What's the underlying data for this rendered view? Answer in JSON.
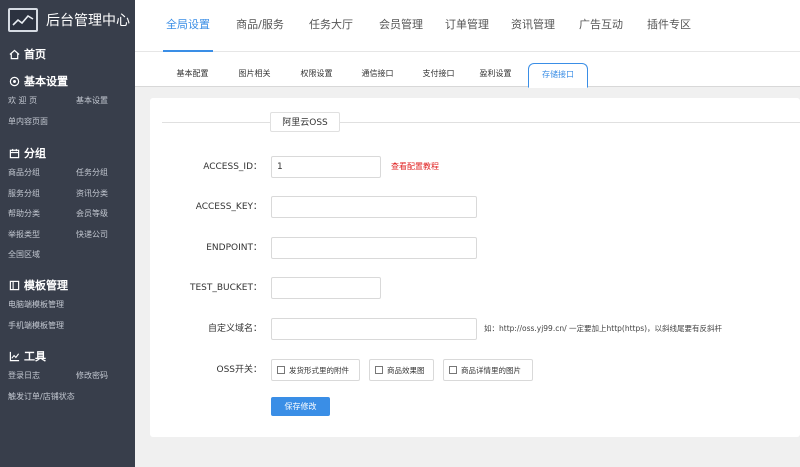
{
  "brand": {
    "title": "后台管理中心",
    "icon": "monitor-chart-icon"
  },
  "sidebar": {
    "sections": [
      {
        "title": "首页",
        "icon": "home-icon",
        "items": []
      },
      {
        "title": "基本设置",
        "icon": "settings-icon",
        "items": [
          "欢 迎 页",
          "基本设置",
          "单内容页面"
        ]
      },
      {
        "title": "分组",
        "icon": "calendar-icon",
        "items": [
          "商品分组",
          "任务分组",
          "服务分组",
          "资讯分类",
          "帮助分类",
          "会员等级",
          "举报类型",
          "快递公司",
          "全国区域"
        ]
      },
      {
        "title": "模板管理",
        "icon": "template-icon",
        "items": [
          "电脑端模板管理",
          "手机端模板管理"
        ]
      },
      {
        "title": "工具",
        "icon": "chart-icon",
        "items": [
          "登录日志",
          "修改密码",
          "触发订单/店铺状态"
        ]
      }
    ]
  },
  "topnav": {
    "items": [
      "全局设置",
      "商品/服务",
      "任务大厅",
      "会员管理",
      "订单管理",
      "资讯管理",
      "广告互动",
      "插件专区"
    ],
    "active_index": 0
  },
  "subtabs": {
    "items": [
      "基本配置",
      "图片相关",
      "权限设置",
      "通信接口",
      "支付接口",
      "盈利设置",
      "存储接口"
    ],
    "active_index": 6
  },
  "form": {
    "legend": "阿里云OSS",
    "access_id": {
      "label": "ACCESS_ID：",
      "value": "1",
      "help": "查看配置教程"
    },
    "access_key": {
      "label": "ACCESS_KEY：",
      "value": ""
    },
    "endpoint": {
      "label": "ENDPOINT：",
      "value": ""
    },
    "test_bucket": {
      "label": "TEST_BUCKET：",
      "value": ""
    },
    "custom_domain": {
      "label": "自定义域名：",
      "value": "",
      "hint": "如：http://oss.yj99.cn/ 一定要加上http(https)，以斜线尾要有反斜杆"
    },
    "oss_switch": {
      "label": "OSS开关：",
      "options": [
        "发货形式里的附件",
        "商品效果图",
        "商品详情里的图片"
      ]
    },
    "save_label": "保存修改"
  },
  "colors": {
    "accent": "#3a8ee6",
    "sidebar_bg": "#383e4b",
    "error": "#e02020"
  }
}
